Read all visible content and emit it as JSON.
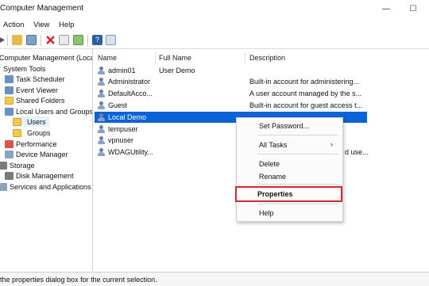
{
  "window": {
    "title": "Computer Management",
    "minimize_glyph": "—",
    "maximize_glyph": "☐"
  },
  "menubar": {
    "action": "Action",
    "view": "View",
    "help": "Help"
  },
  "tree": {
    "root": "Computer Management (Local",
    "system_tools": "System Tools",
    "task_scheduler": "Task Scheduler",
    "event_viewer": "Event Viewer",
    "shared_folders": "Shared Folders",
    "local_users_groups": "Local Users and Groups",
    "users": "Users",
    "groups": "Groups",
    "performance": "Performance",
    "device_manager": "Device Manager",
    "storage": "Storage",
    "disk_management": "Disk Management",
    "services": "Services and Applications"
  },
  "list": {
    "columns": {
      "name": "Name",
      "full_name": "Full Name",
      "description": "Description"
    },
    "rows": [
      {
        "name": "admin01",
        "full_name": "User Demo",
        "description": ""
      },
      {
        "name": "Administrator",
        "full_name": "",
        "description": "Built-in account for administering..."
      },
      {
        "name": "DefaultAcco...",
        "full_name": "",
        "description": "A user account managed by the s..."
      },
      {
        "name": "Guest",
        "full_name": "",
        "description": "Built-in account for guest access t..."
      },
      {
        "name": "Local Demo",
        "full_name": "",
        "description": ""
      },
      {
        "name": "tempuser",
        "full_name": "",
        "description": ""
      },
      {
        "name": "vpnuser",
        "full_name": "",
        "description": ""
      },
      {
        "name": "WDAGUtility...",
        "full_name": "",
        "description": "d use..."
      }
    ]
  },
  "context_menu": {
    "set_password": "Set Password...",
    "all_tasks": "All Tasks",
    "all_tasks_arrow": "›",
    "delete": "Delete",
    "rename": "Rename",
    "properties": "Properties",
    "help": "Help"
  },
  "status": {
    "text": "the properties dialog box for the current selection."
  }
}
